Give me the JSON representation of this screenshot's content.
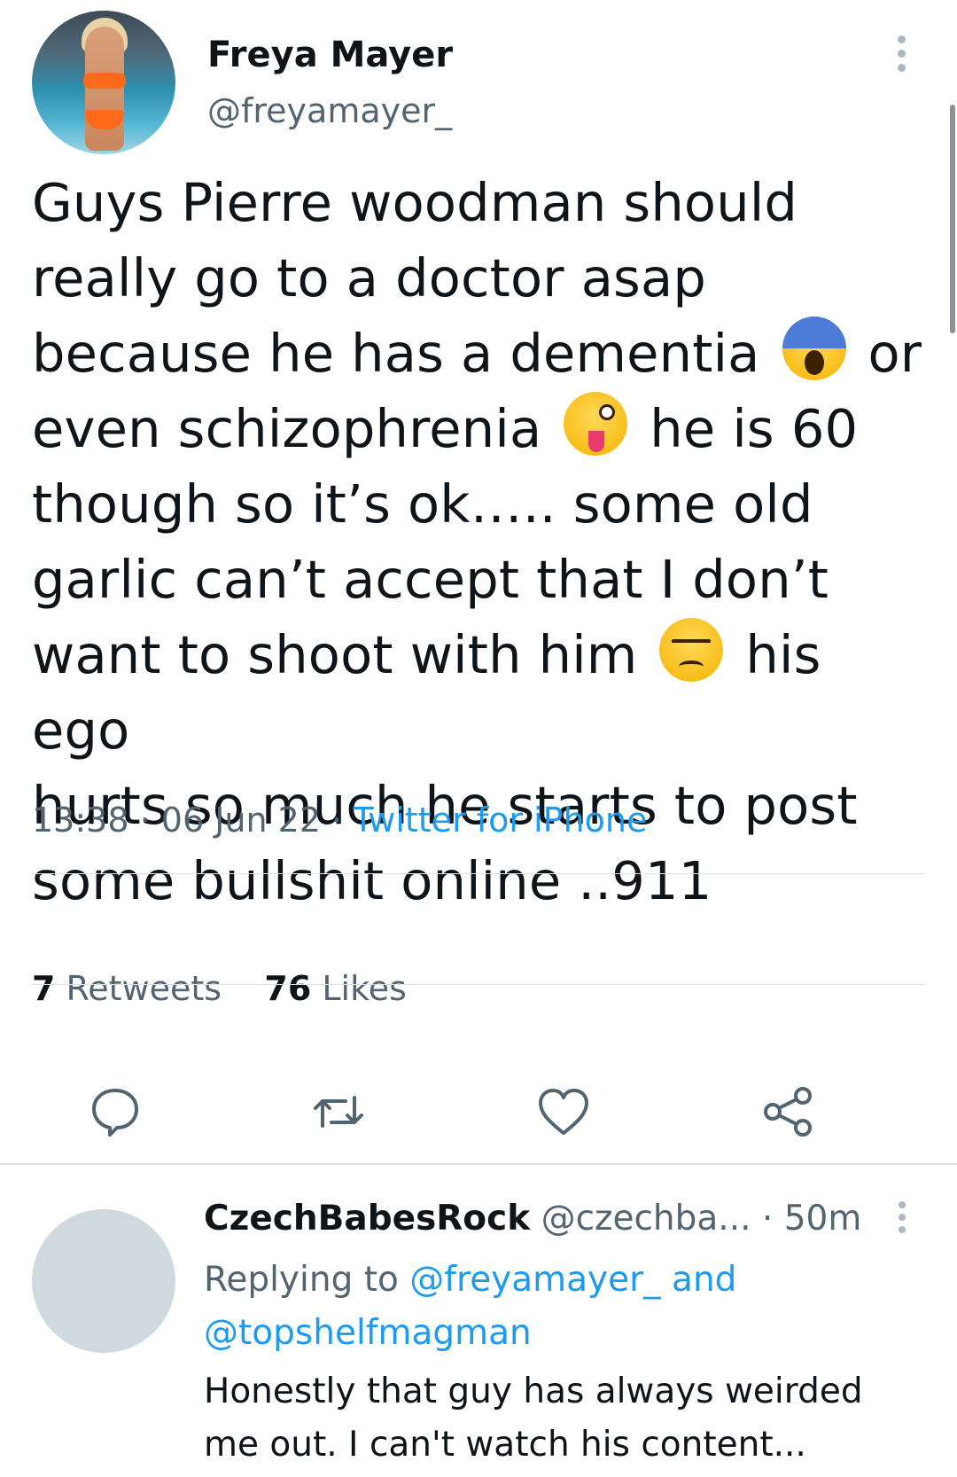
{
  "tweet": {
    "author_name": "Freya Mayer",
    "author_handle": "@freyamayer_",
    "text_lines": [
      "Guys Pierre woodman should",
      "really go to a doctor asap",
      "because he has a dementia",
      "or",
      "even schizophrenia",
      "he is 60",
      "though so it’s ok….. some old",
      "garlic can’t accept that I don’t",
      "want to shoot with him",
      "his ego",
      "hurts so much he starts to post",
      "some bullshit online ..911"
    ],
    "emojis": [
      "face-screaming-in-fear",
      "winking-face-with-tongue",
      "unamused-face"
    ],
    "time": "13:38",
    "date": "06 Jun 22",
    "separator": "·",
    "source": "Twitter for iPhone",
    "retweets_count": "7",
    "retweets_label": "Retweets",
    "likes_count": "76",
    "likes_label": "Likes"
  },
  "actions": {
    "icons": [
      "reply-icon",
      "retweet-icon",
      "like-icon",
      "share-icon"
    ]
  },
  "reply": {
    "name": "CzechBabesRock",
    "handle": "@czechba...",
    "time": "· 50m",
    "replying_prefix": "Replying to",
    "replying_to": "@freyamayer_ and",
    "replying_to_2": "@topshelfmagman",
    "text_line1": "Honestly that guy has always weirded",
    "text_line2": "me out. I can't watch his content..."
  },
  "colors": {
    "accent": "#1d9bf0",
    "secondary_text": "#536471",
    "primary_text": "#0f1419",
    "divider": "#dce3e8"
  }
}
